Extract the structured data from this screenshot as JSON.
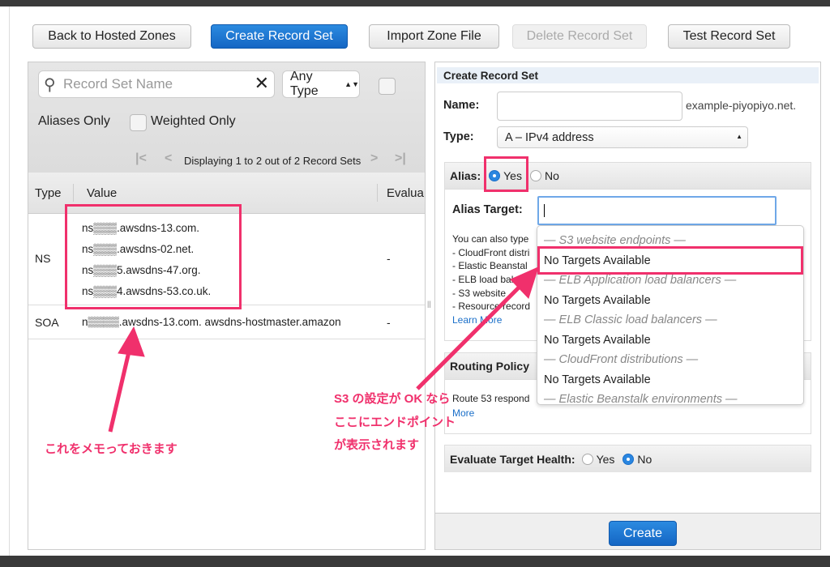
{
  "toolbar": {
    "back": "Back to Hosted Zones",
    "create": "Create Record Set",
    "import": "Import Zone File",
    "delete": "Delete Record Set",
    "test": "Test Record Set"
  },
  "filter": {
    "search_placeholder": "Record Set Name",
    "type_select": "Any Type",
    "aliases_only": "Aliases Only",
    "weighted_only": "Weighted Only",
    "pagination": "Displaying 1 to 2 out of 2 Record Sets"
  },
  "table": {
    "columns": [
      "Type",
      "Value",
      "Evalua"
    ],
    "rows": [
      {
        "type": "NS",
        "values": [
          "ns▒▒▒.awsdns-13.com.",
          "ns▒▒▒.awsdns-02.net.",
          "ns▒▒▒5.awsdns-47.org.",
          "ns▒▒▒4.awsdns-53.co.uk."
        ],
        "evaluate": "-"
      },
      {
        "type": "SOA",
        "values": [
          "n▒▒▒▒.awsdns-13.com. awsdns-hostmaster.amazon"
        ],
        "evaluate": "-"
      }
    ]
  },
  "form": {
    "title": "Create Record Set",
    "name_label": "Name:",
    "name_value": "",
    "domain_suffix": "example-piyopiyo.net.",
    "type_label": "Type:",
    "type_value": "A – IPv4 address",
    "alias_label": "Alias:",
    "alias_yes": "Yes",
    "alias_no": "No",
    "alias_selected": "Yes",
    "alias_target_label": "Alias Target:",
    "alias_target_value": "",
    "help_lines": [
      "You can also type",
      "-  CloudFront distri",
      "-  Elastic Beanstal",
      "-  ELB load balan",
      "-  S3 website",
      "-  Resource record"
    ],
    "learn_more": "Learn More",
    "routing_label": "Routing Policy",
    "routing_text": "Route 53 respond",
    "routing_more": "More",
    "eval_label": "Evaluate Target Health:",
    "eval_yes": "Yes",
    "eval_no": "No",
    "eval_selected": "No",
    "create": "Create"
  },
  "dropdown": [
    {
      "kind": "group",
      "label": "— S3 website endpoints —"
    },
    {
      "kind": "item",
      "label": "No Targets Available"
    },
    {
      "kind": "group",
      "label": "— ELB Application load balancers —"
    },
    {
      "kind": "item",
      "label": "No Targets Available"
    },
    {
      "kind": "group",
      "label": "— ELB Classic load balancers —"
    },
    {
      "kind": "item",
      "label": "No Targets Available"
    },
    {
      "kind": "group",
      "label": "— CloudFront distributions —"
    },
    {
      "kind": "item",
      "label": "No Targets Available"
    },
    {
      "kind": "group",
      "label": "— Elastic Beanstalk environments —"
    }
  ],
  "annotations": {
    "memo": "これをメモっておきます",
    "s3_line1": "S3 の設定が OK なら",
    "s3_line2": "ここにエンドポイント",
    "s3_line3": "が表示されます"
  },
  "colors": {
    "accent": "#1a6fc9",
    "annotation": "#f0306c"
  }
}
